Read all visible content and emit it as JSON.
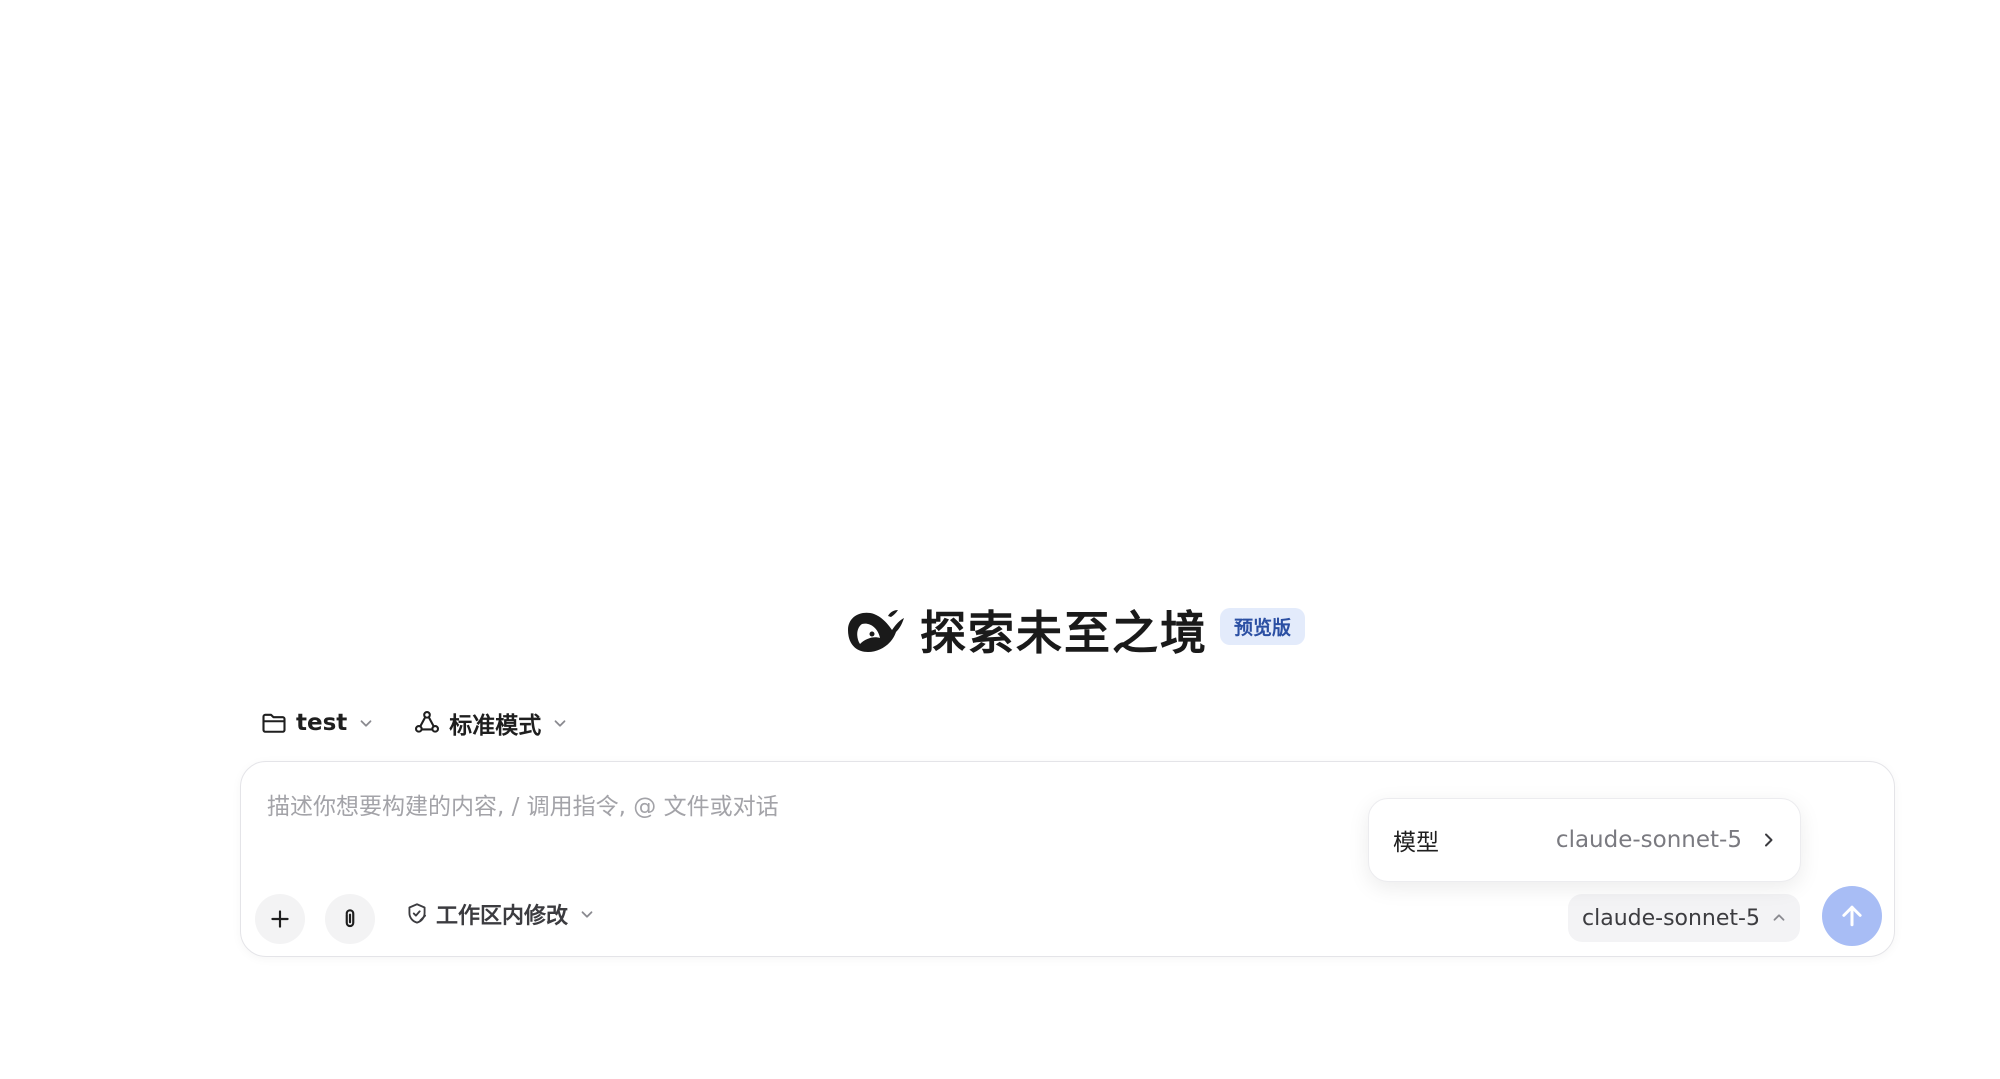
{
  "hero": {
    "title": "探索未至之境",
    "badge": "预览版"
  },
  "selectors": {
    "workspace": {
      "label": "test",
      "icon": "folder-icon"
    },
    "mode": {
      "label": "标准模式",
      "icon": "agent-mode-icon"
    }
  },
  "composer": {
    "placeholder": "描述你想要构建的内容, / 调用指令, @ 文件或对话",
    "value": "",
    "add_icon": "plus-icon",
    "attach_icon": "paperclip-icon",
    "permission": {
      "label": "工作区内修改",
      "icon": "shield-edit-icon"
    },
    "model_pill": {
      "label": "claude-sonnet-5",
      "icon": "chevron-up-icon"
    },
    "send_icon": "arrow-up-icon"
  },
  "model_popover": {
    "key": "模型",
    "value": "claude-sonnet-5",
    "icon": "chevron-right-icon"
  },
  "colors": {
    "accent_send": "#a8bdf5",
    "badge_bg": "#e3ebfb",
    "badge_text": "#2b4fa3",
    "placeholder": "#a3a3a8"
  }
}
